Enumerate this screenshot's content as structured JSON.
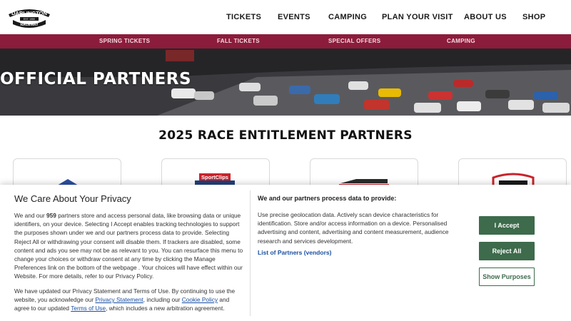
{
  "brand": {
    "logo_text": "DARLINGTON",
    "logo_sub": "RACEWAY",
    "logo_est": "EST. 1950"
  },
  "main_nav": [
    "TICKETS",
    "EVENTS",
    "CAMPING",
    "PLAN YOUR VISIT",
    "ABOUT US",
    "SHOP"
  ],
  "sub_nav": [
    "SPRING TICKETS",
    "FALL TICKETS",
    "SPECIAL OFFERS",
    "CAMPING"
  ],
  "hero": {
    "title": "OFFICIAL PARTNERS"
  },
  "section": {
    "title": "2025 RACE ENTITLEMENT PARTNERS",
    "partner_logo_text": "SportClips"
  },
  "consent": {
    "title": "We Care About Your Privacy",
    "p1_before": "We and our ",
    "p1_count": "959",
    "p1_after": " partners store and access personal data, like browsing data or unique identifiers, on your device. Selecting I Accept enables tracking technologies to support the purposes shown under we and our partners process data to provide. Selecting Reject All or withdrawing your consent will disable them. If trackers are disabled, some content and ads you see may not be as relevant to you. You can resurface this menu to change your choices or withdraw consent at any time by clicking the Manage Preferences link on the bottom of the webpage . Your choices will have effect within our Website. For more details, refer to our Privacy Policy.",
    "p2_a": "We have updated our Privacy Statement and Terms of Use. By continuing to use the website, you acknowledge our ",
    "privacy_link": "Privacy Statement",
    "p2_b": ", including our ",
    "cookie_link": "Cookie Policy",
    "p2_c": " and agree to our updated ",
    "terms_link": "Terms of Use",
    "p2_d": ", which includes a new arbitration agreement.",
    "mid_heading": "We and our partners process data to provide:",
    "mid_text": "Use precise geolocation data. Actively scan device characteristics for identification. Store and/or access information on a device. Personalised advertising and content, advertising and content measurement, audience research and services development.",
    "partners_link": "List of Partners (vendors)",
    "accept_label": "I Accept",
    "reject_label": "Reject All",
    "purposes_label": "Show Purposes"
  },
  "colors": {
    "accent_maroon": "#8c1c3b",
    "button_green": "#3d6b4b",
    "link_blue": "#1a4fa0"
  }
}
